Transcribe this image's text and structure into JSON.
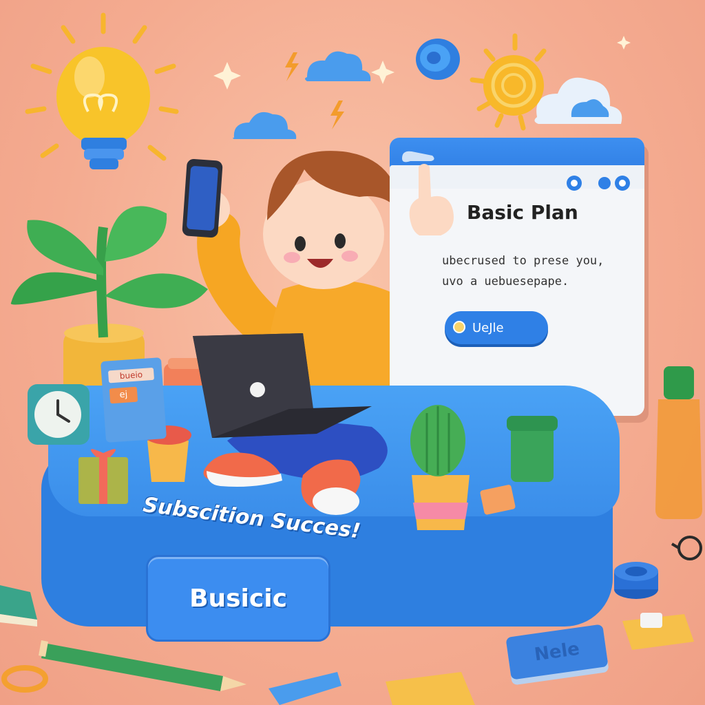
{
  "popup": {
    "title": "Basic Plan",
    "body_line1": "ubecrused to prese you,",
    "body_line2": "uvo a uebuesepape.",
    "button_label": "UeJle"
  },
  "platform": {
    "label": "Busicic",
    "success_text": "Subscition Succes!"
  },
  "props": {
    "card_label": "bueio",
    "card_sub": "ej",
    "eraser_label": "Nele"
  },
  "colors": {
    "background": "#f4ab90",
    "platform_blue": "#3b8eea",
    "popup_bar_blue": "#2b78e0",
    "character_shirt": "#f6a623",
    "accent_yellow": "#f8c42a"
  },
  "icons": [
    "lightbulb-icon",
    "sun-icon",
    "cloud-icon",
    "sparkle-icon",
    "lightning-icon",
    "target-icon",
    "plant-icon",
    "cactus-icon",
    "clock-icon",
    "gift-icon",
    "laptop-icon",
    "phone-icon",
    "pencil-icon",
    "glasses-icon",
    "bottle-icon",
    "box-icon",
    "cup-icon",
    "book-icon"
  ]
}
